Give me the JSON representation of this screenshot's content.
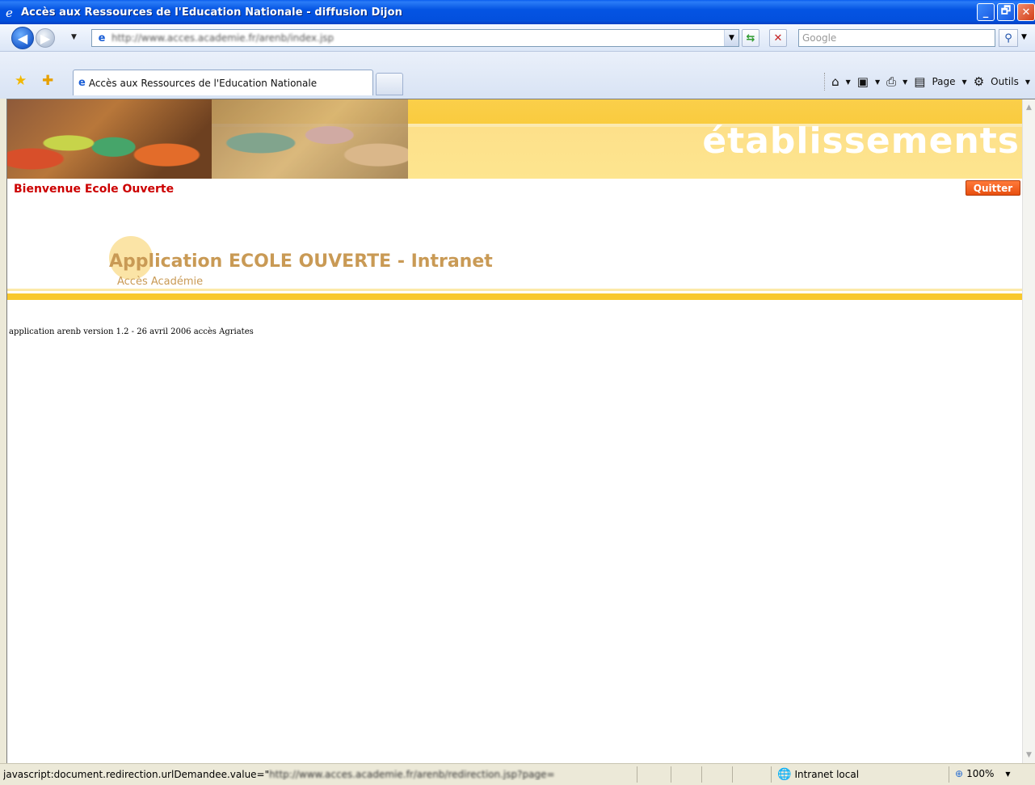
{
  "window": {
    "title": "Accès aux Ressources de l'Education Nationale - diffusion Dijon",
    "minimize": "_",
    "maximize": "🗗",
    "close": "✕"
  },
  "address_bar": {
    "url": "http://www.acces.academie.fr/arenb/index.jsp",
    "search_placeholder": "Google"
  },
  "tabs": [
    {
      "label": "Accès aux Ressources de l'Education Nationale"
    }
  ],
  "command_bar": {
    "page_label": "Page",
    "tools_label": "Outils"
  },
  "page": {
    "banner_word": "établissements",
    "welcome": "Bienvenue Ecole Ouverte",
    "quit_button": "Quitter",
    "app_title": "Application ECOLE OUVERTE - Intranet",
    "app_subtitle": "Accès Académie",
    "version_line": "application arenb version 1.2 - 26 avril 2006 accès Agriates"
  },
  "status_bar": {
    "prefix": "javascript:document.redirection.urlDemandee.value=\"",
    "blurred": "http://www.acces.academie.fr/arenb/redirection.jsp?page=",
    "zone": "Intranet local",
    "zoom": "100%"
  },
  "colors": {
    "welcome": "#cc0000",
    "quit_button": "#e84f10",
    "app_title": "#c99a55",
    "banner_yellow": "#f9cb3e"
  },
  "icons": {
    "back": "back-arrow-icon",
    "forward": "forward-arrow-icon",
    "refresh": "refresh-icon",
    "stop": "stop-icon",
    "search": "search-icon",
    "favorites": "favorites-star-icon",
    "home": "home-icon",
    "feeds": "rss-feed-icon",
    "print": "printer-icon",
    "zone": "globe-icon",
    "zoom": "magnifier-icon"
  }
}
